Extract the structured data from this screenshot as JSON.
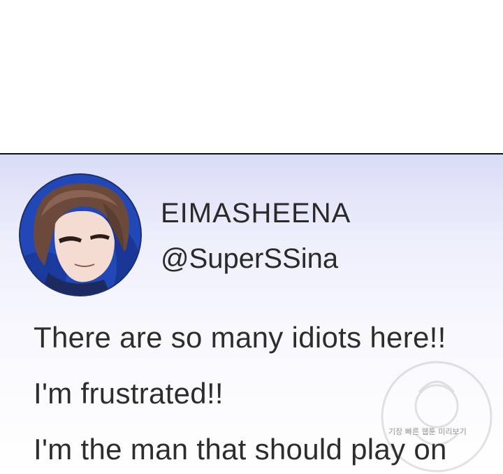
{
  "profile": {
    "display_name": "EIMASHEENA",
    "handle": "@SuperSSina",
    "avatar_icon": "character-portrait-avatar"
  },
  "post": {
    "lines": [
      "There are so many idiots here!!",
      "I'm frustrated!!",
      "I'm the man that should play on"
    ]
  },
  "watermark": {
    "text": "기장 빠른 웹툰 미리보기",
    "icon": "mascot-logo"
  },
  "colors": {
    "panel_top": "#d9dcf6",
    "panel_bottom": "#ffffff",
    "text": "#2d2d2d",
    "avatar_ring": "#1f3fa5"
  }
}
